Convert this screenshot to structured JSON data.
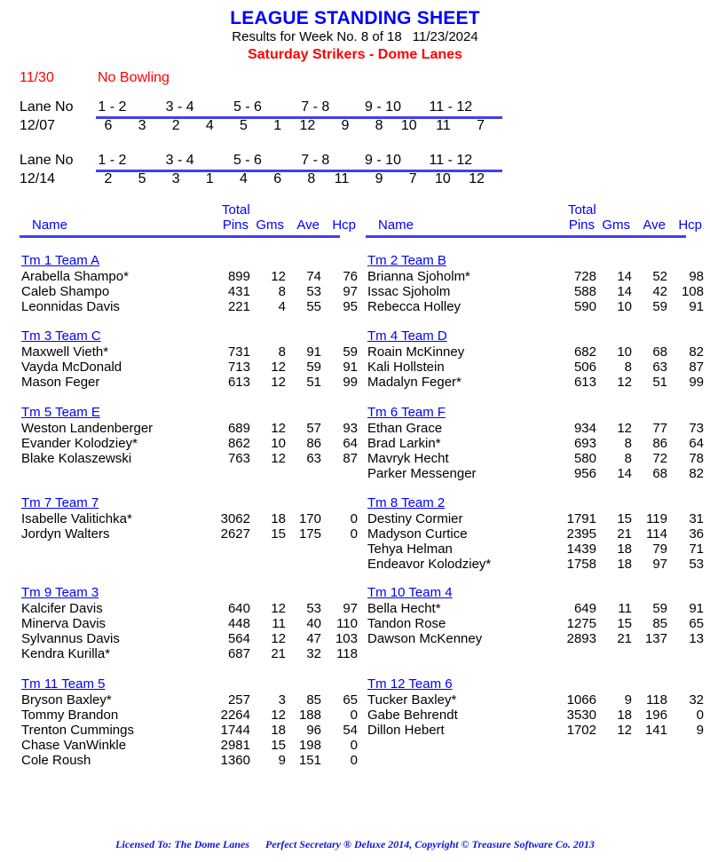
{
  "header": {
    "title": "LEAGUE STANDING SHEET",
    "results_line": "Results for Week No. 8 of 18",
    "results_date": "11/23/2024",
    "league_line": "Saturday Strikers - Dome Lanes",
    "title_color": "#0000ff",
    "league_color": "#ff0000"
  },
  "notice": {
    "date": "11/30",
    "text": "No Bowling",
    "color": "#ff0000"
  },
  "lane_schedule": {
    "label": "Lane No",
    "pair_headers": [
      "1 - 2",
      "3 - 4",
      "5 - 6",
      "7 - 8",
      "9 - 10",
      "11 - 12"
    ],
    "rule_color": "#4040ef",
    "weeks": [
      {
        "date": "12/07",
        "matchups": [
          [
            "6",
            "3"
          ],
          [
            "2",
            "4"
          ],
          [
            "5",
            "1"
          ],
          [
            "12",
            "9"
          ],
          [
            "8",
            "10"
          ],
          [
            "11",
            "7"
          ]
        ]
      },
      {
        "date": "12/14",
        "matchups": [
          [
            "2",
            "5"
          ],
          [
            "3",
            "1"
          ],
          [
            "4",
            "6"
          ],
          [
            "8",
            "11"
          ],
          [
            "9",
            "7"
          ],
          [
            "10",
            "12"
          ]
        ]
      }
    ]
  },
  "table_header": {
    "total": "Total",
    "name": "Name",
    "pins": "Pins",
    "gms": "Gms",
    "ave": "Ave",
    "hcp": "Hcp",
    "color": "#0000ff"
  },
  "left_column": [
    {
      "team": "Tm 1 Team A",
      "bowlers": [
        {
          "name": "Arabella Shampo*",
          "pins": "899",
          "gms": "12",
          "ave": "74",
          "hcp": "76"
        },
        {
          "name": "Caleb Shampo",
          "pins": "431",
          "gms": "8",
          "ave": "53",
          "hcp": "97"
        },
        {
          "name": "Leonnidas Davis",
          "pins": "221",
          "gms": "4",
          "ave": "55",
          "hcp": "95"
        }
      ]
    },
    {
      "team": "Tm 3 Team C",
      "bowlers": [
        {
          "name": "Maxwell Vieth*",
          "pins": "731",
          "gms": "8",
          "ave": "91",
          "hcp": "59"
        },
        {
          "name": "Vayda McDonald",
          "pins": "713",
          "gms": "12",
          "ave": "59",
          "hcp": "91"
        },
        {
          "name": "Mason Feger",
          "pins": "613",
          "gms": "12",
          "ave": "51",
          "hcp": "99"
        }
      ]
    },
    {
      "team": "Tm 5 Team E",
      "bowlers": [
        {
          "name": "Weston Landenberger",
          "pins": "689",
          "gms": "12",
          "ave": "57",
          "hcp": "93"
        },
        {
          "name": "Evander Kolodziey*",
          "pins": "862",
          "gms": "10",
          "ave": "86",
          "hcp": "64"
        },
        {
          "name": "Blake Kolaszewski",
          "pins": "763",
          "gms": "12",
          "ave": "63",
          "hcp": "87"
        }
      ]
    },
    {
      "team": "Tm 7 Team 7",
      "bowlers": [
        {
          "name": "Isabelle Valitichka*",
          "pins": "3062",
          "gms": "18",
          "ave": "170",
          "hcp": "0"
        },
        {
          "name": "Jordyn Walters",
          "pins": "2627",
          "gms": "15",
          "ave": "175",
          "hcp": "0"
        }
      ]
    },
    {
      "team": "Tm 9 Team 3",
      "bowlers": [
        {
          "name": "Kalcifer Davis",
          "pins": "640",
          "gms": "12",
          "ave": "53",
          "hcp": "97"
        },
        {
          "name": "Minerva Davis",
          "pins": "448",
          "gms": "11",
          "ave": "40",
          "hcp": "110"
        },
        {
          "name": "Sylvannus Davis",
          "pins": "564",
          "gms": "12",
          "ave": "47",
          "hcp": "103"
        },
        {
          "name": "Kendra Kurilla*",
          "pins": "687",
          "gms": "21",
          "ave": "32",
          "hcp": "118"
        }
      ]
    },
    {
      "team": "Tm 11 Team 5",
      "bowlers": [
        {
          "name": "Bryson Baxley*",
          "pins": "257",
          "gms": "3",
          "ave": "85",
          "hcp": "65"
        },
        {
          "name": "Tommy Brandon",
          "pins": "2264",
          "gms": "12",
          "ave": "188",
          "hcp": "0"
        },
        {
          "name": "Trenton Cummings",
          "pins": "1744",
          "gms": "18",
          "ave": "96",
          "hcp": "54"
        },
        {
          "name": "Chase VanWinkle",
          "pins": "2981",
          "gms": "15",
          "ave": "198",
          "hcp": "0"
        },
        {
          "name": "Cole Roush",
          "pins": "1360",
          "gms": "9",
          "ave": "151",
          "hcp": "0"
        }
      ]
    }
  ],
  "right_column": [
    {
      "team": "Tm 2 Team B",
      "bowlers": [
        {
          "name": "Brianna Sjoholm*",
          "pins": "728",
          "gms": "14",
          "ave": "52",
          "hcp": "98"
        },
        {
          "name": "Issac Sjoholm",
          "pins": "588",
          "gms": "14",
          "ave": "42",
          "hcp": "108"
        },
        {
          "name": "Rebecca Holley",
          "pins": "590",
          "gms": "10",
          "ave": "59",
          "hcp": "91"
        }
      ]
    },
    {
      "team": "Tm 4 Team D",
      "bowlers": [
        {
          "name": "Roain McKinney",
          "pins": "682",
          "gms": "10",
          "ave": "68",
          "hcp": "82"
        },
        {
          "name": "Kali Hollstein",
          "pins": "506",
          "gms": "8",
          "ave": "63",
          "hcp": "87"
        },
        {
          "name": "Madalyn Feger*",
          "pins": "613",
          "gms": "12",
          "ave": "51",
          "hcp": "99"
        }
      ]
    },
    {
      "team": "Tm 6 Team F",
      "bowlers": [
        {
          "name": "Ethan Grace",
          "pins": "934",
          "gms": "12",
          "ave": "77",
          "hcp": "73"
        },
        {
          "name": "Brad Larkin*",
          "pins": "693",
          "gms": "8",
          "ave": "86",
          "hcp": "64"
        },
        {
          "name": "Mavryk Hecht",
          "pins": "580",
          "gms": "8",
          "ave": "72",
          "hcp": "78"
        },
        {
          "name": "Parker Messenger",
          "pins": "956",
          "gms": "14",
          "ave": "68",
          "hcp": "82"
        }
      ]
    },
    {
      "team": "Tm 8 Team 2",
      "bowlers": [
        {
          "name": "Destiny Cormier",
          "pins": "1791",
          "gms": "15",
          "ave": "119",
          "hcp": "31"
        },
        {
          "name": "Madyson Curtice",
          "pins": "2395",
          "gms": "21",
          "ave": "114",
          "hcp": "36"
        },
        {
          "name": "Tehya Helman",
          "pins": "1439",
          "gms": "18",
          "ave": "79",
          "hcp": "71"
        },
        {
          "name": "Endeavor Kolodziey*",
          "pins": "1758",
          "gms": "18",
          "ave": "97",
          "hcp": "53"
        }
      ]
    },
    {
      "team": "Tm 10 Team 4",
      "bowlers": [
        {
          "name": "Bella Hecht*",
          "pins": "649",
          "gms": "11",
          "ave": "59",
          "hcp": "91"
        },
        {
          "name": "Tandon Rose",
          "pins": "1275",
          "gms": "15",
          "ave": "85",
          "hcp": "65"
        },
        {
          "name": "Dawson McKenney",
          "pins": "2893",
          "gms": "21",
          "ave": "137",
          "hcp": "13"
        }
      ]
    },
    {
      "team": "Tm 12 Team 6",
      "bowlers": [
        {
          "name": "Tucker Baxley*",
          "pins": "1066",
          "gms": "9",
          "ave": "118",
          "hcp": "32"
        },
        {
          "name": "Gabe Behrendt",
          "pins": "3530",
          "gms": "18",
          "ave": "196",
          "hcp": "0"
        },
        {
          "name": "Dillon Hebert",
          "pins": "1702",
          "gms": "12",
          "ave": "141",
          "hcp": "9"
        }
      ]
    }
  ],
  "footer": {
    "licensed_to": "Licensed To: The Dome Lanes",
    "software": "Perfect Secretary ® Deluxe  2014, Copyright © Treasure Software Co. 2013",
    "color": "#1515e0"
  }
}
